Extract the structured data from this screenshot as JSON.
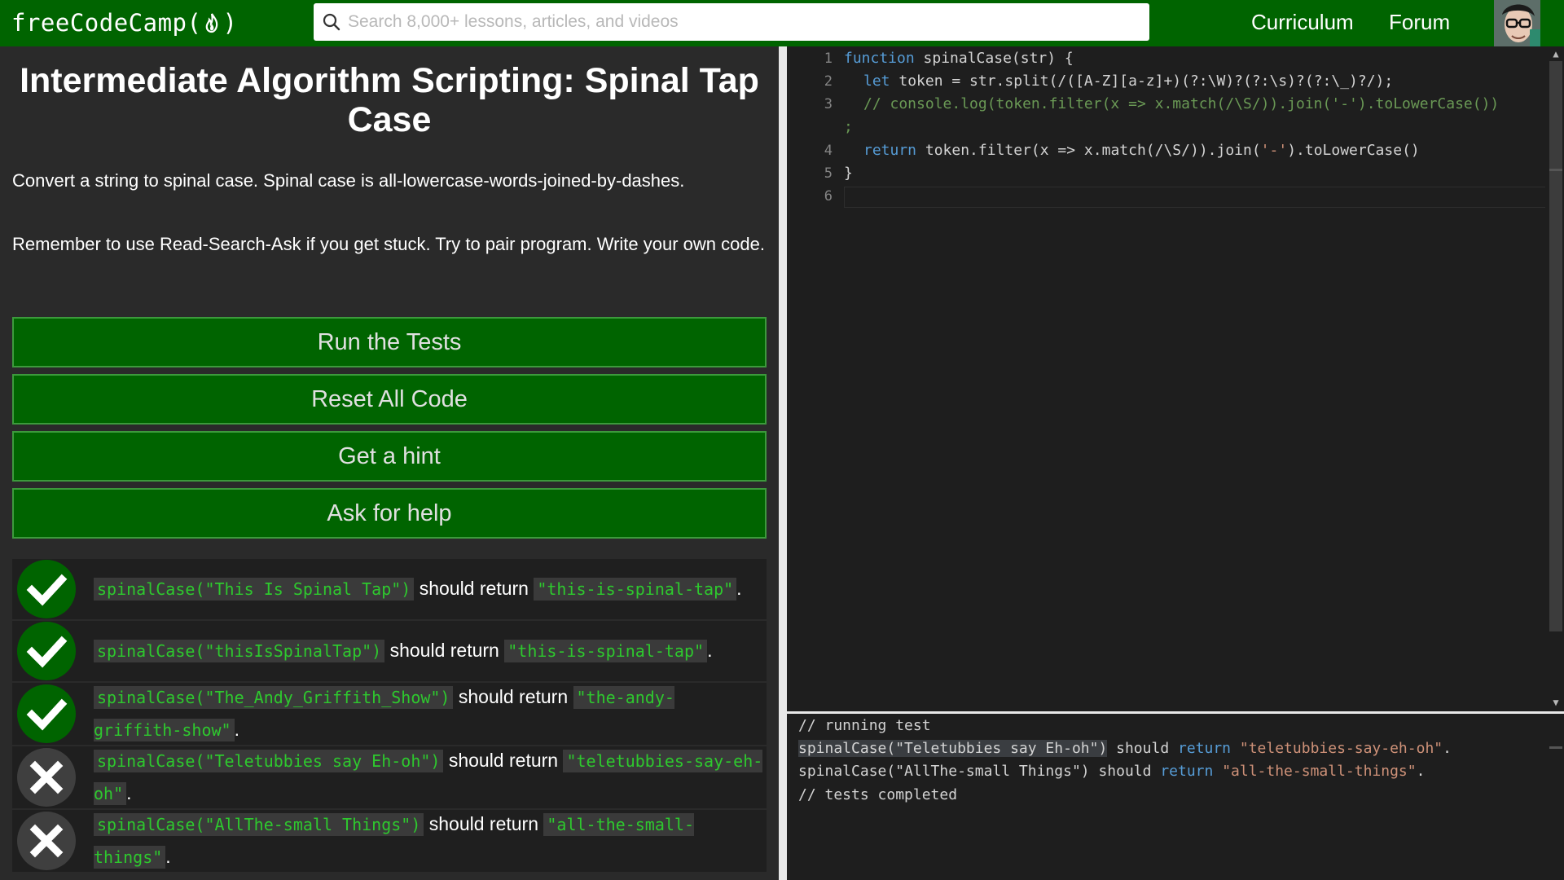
{
  "nav": {
    "brand_prefix": "freeCodeCamp(",
    "brand_suffix": ")",
    "search_placeholder": "Search 8,000+ lessons, articles, and videos",
    "links": [
      "Curriculum",
      "Forum"
    ],
    "icons": [
      "flame-icon",
      "search-icon",
      "avatar"
    ]
  },
  "challenge": {
    "title": "Intermediate Algorithm Scripting: Spinal Tap Case",
    "description": "Convert a string to spinal case. Spinal case is all-lowercase-words-joined-by-dashes.",
    "reminder": "Remember to use Read-Search-Ask if you get stuck. Try to pair program. Write your own code."
  },
  "buttons": {
    "run": "Run the Tests",
    "reset": "Reset All Code",
    "hint": "Get a hint",
    "help": "Ask for help"
  },
  "tests": [
    {
      "status": "pass",
      "call": "spinalCase(\"This Is Spinal Tap\")",
      "mid": " should return ",
      "expected": "\"this-is-spinal-tap\"",
      "end": "."
    },
    {
      "status": "pass",
      "call": "spinalCase(\"thisIsSpinalTap\")",
      "mid": " should return ",
      "expected": "\"this-is-spinal-tap\"",
      "end": "."
    },
    {
      "status": "pass",
      "call": "spinalCase(\"The_Andy_Griffith_Show\")",
      "mid": " should return ",
      "expected": "\"the-andy-griffith-show\"",
      "end": "."
    },
    {
      "status": "fail",
      "call": "spinalCase(\"Teletubbies say Eh-oh\")",
      "mid": " should return ",
      "expected": "\"teletubbies-say-eh-oh\"",
      "end": "."
    },
    {
      "status": "fail",
      "call": "spinalCase(\"AllThe-small Things\")",
      "mid": " should return ",
      "expected": "\"all-the-small-things\"",
      "end": "."
    }
  ],
  "editor": {
    "line_numbers": [
      "1",
      "2",
      "3",
      "4",
      "5",
      "6"
    ],
    "l1_kw": "function",
    "l1_rest": " spinalCase(str) {",
    "l2_kw": "let",
    "l2_rest": " token = str.split(/([A-Z][a-z]+)(?:\\W)?(?:\\s)?(?:\\_)?/);",
    "l3_comment": "// console.log(token.filter(x => x.match(/\\S/)).join('-').toLowerCase())",
    "l3_wrap": ";",
    "l4_kw": "return",
    "l4_pre": " token.filter(x => x.match(/\\S/)).join(",
    "l4_str": "'-'",
    "l4_post": ").toLowerCase()",
    "l5": "}"
  },
  "console": {
    "line1": "// running test",
    "line2_call": "spinalCase(\"Teletubbies say Eh-oh\")",
    "line2_mid": " should ",
    "line2_kw": "return",
    "line2_str": " \"teletubbies-say-eh-oh\"",
    "line2_end": ".",
    "line3_call": "spinalCase(\"AllThe-small Things\")",
    "line3_mid": " should ",
    "line3_kw": "return",
    "line3_str": " \"all-the-small-things\"",
    "line3_end": ".",
    "line4": "// tests completed"
  },
  "colors": {
    "brand_green": "#006400",
    "code_green": "#2ec82e",
    "panel_bg": "#2a2a2a",
    "editor_bg": "#1e1e1e"
  }
}
